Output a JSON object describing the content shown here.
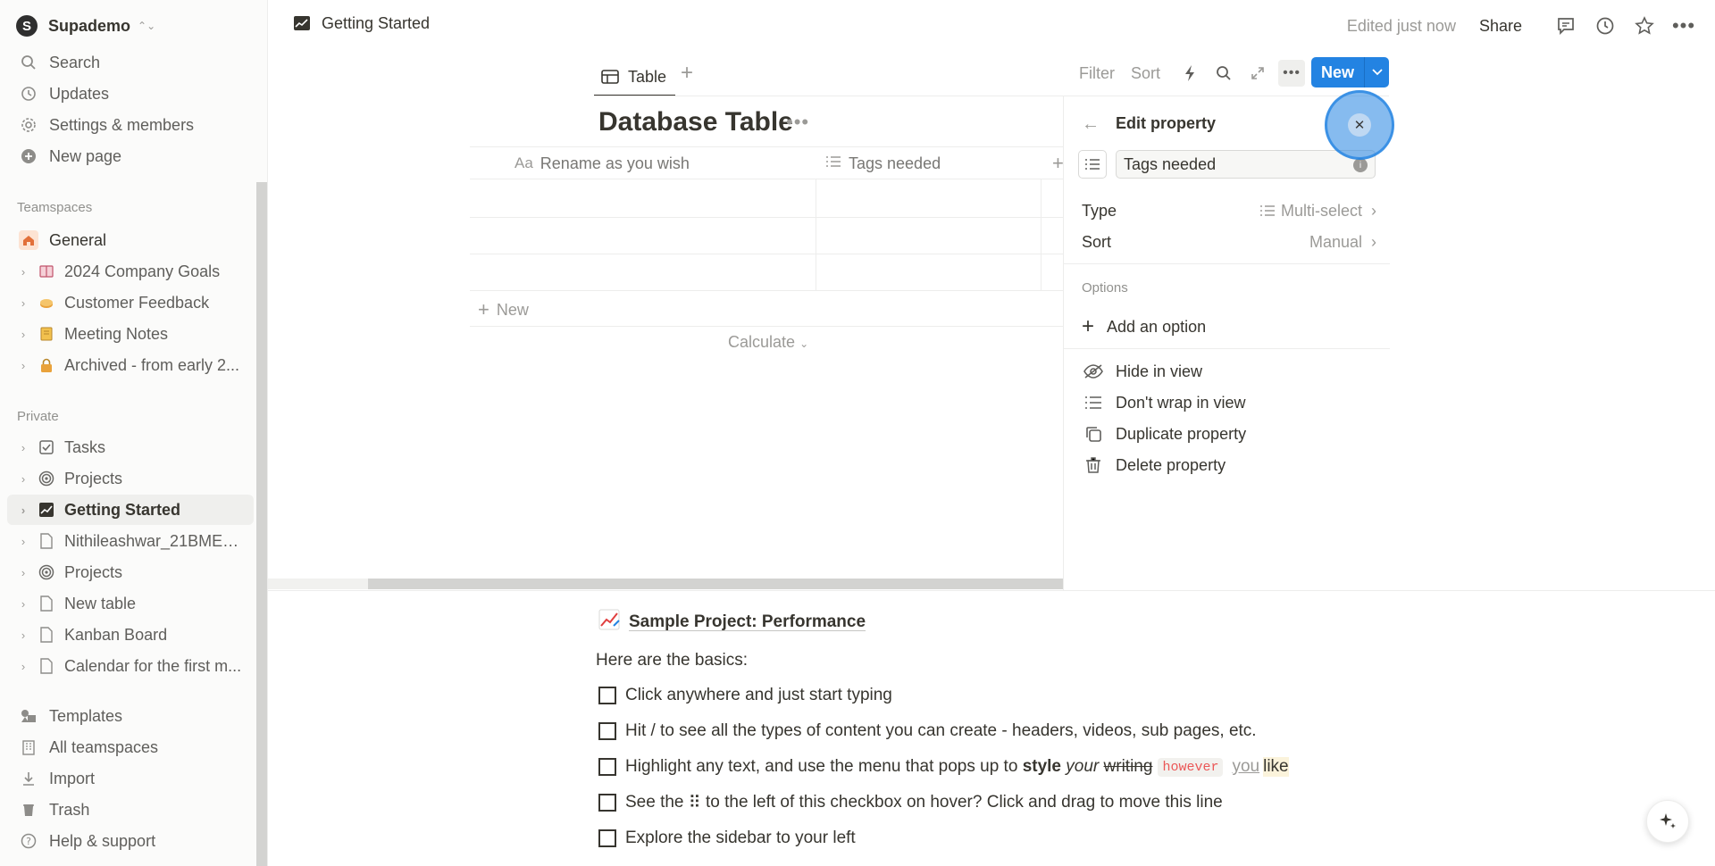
{
  "workspace": {
    "initial": "S",
    "name": "Supademo"
  },
  "sidebar": {
    "top_items": [
      {
        "label": "Search",
        "icon": "search-icon"
      },
      {
        "label": "Updates",
        "icon": "clock-icon"
      },
      {
        "label": "Settings & members",
        "icon": "gear-icon"
      },
      {
        "label": "New page",
        "icon": "plus-circle-icon"
      }
    ],
    "teamspaces_label": "Teamspaces",
    "teamspaces": [
      {
        "label": "General",
        "icon": "home-icon"
      },
      {
        "label": "2024 Company Goals",
        "icon": "book-icon"
      },
      {
        "label": "Customer Feedback",
        "icon": "pie-icon"
      },
      {
        "label": "Meeting Notes",
        "icon": "notebook-icon"
      },
      {
        "label": "Archived - from early 2...",
        "icon": "lock-icon"
      }
    ],
    "private_label": "Private",
    "private": [
      {
        "label": "Tasks",
        "icon": "checkbox-icon"
      },
      {
        "label": "Projects",
        "icon": "target-icon"
      },
      {
        "label": "Getting Started",
        "icon": "chart-icon"
      },
      {
        "label": "Nithileashwar_21BME10...",
        "icon": "page-icon"
      },
      {
        "label": "Projects",
        "icon": "target-icon"
      },
      {
        "label": "New table",
        "icon": "page-icon"
      },
      {
        "label": "Kanban Board",
        "icon": "page-icon"
      },
      {
        "label": "Calendar for the first m...",
        "icon": "page-icon"
      }
    ],
    "bottom_items": [
      {
        "label": "Templates",
        "icon": "templates-icon"
      },
      {
        "label": "All teamspaces",
        "icon": "building-icon"
      },
      {
        "label": "Import",
        "icon": "download-icon"
      },
      {
        "label": "Trash",
        "icon": "trash-icon"
      },
      {
        "label": "Help & support",
        "icon": "help-icon"
      }
    ]
  },
  "topbar": {
    "breadcrumb": "Getting Started",
    "edited": "Edited just now",
    "share": "Share"
  },
  "view": {
    "tab_label": "Table",
    "filter": "Filter",
    "sort": "Sort",
    "new_button": "New"
  },
  "database": {
    "title": "Database Table",
    "columns": [
      {
        "prefix": "Aa",
        "label": "Rename as you wish"
      },
      {
        "prefix": "list-icon",
        "label": "Tags needed"
      }
    ],
    "new_row": "New",
    "calculate": "Calculate"
  },
  "panel": {
    "title": "Edit property",
    "name_value": "Tags needed",
    "type_label": "Type",
    "type_value": "Multi-select",
    "sort_label": "Sort",
    "sort_value": "Manual",
    "options_label": "Options",
    "add_option": "Add an option",
    "actions": [
      {
        "label": "Hide in view",
        "icon": "eye-off-icon"
      },
      {
        "label": "Don't wrap in view",
        "icon": "list-icon"
      },
      {
        "label": "Duplicate property",
        "icon": "duplicate-icon"
      },
      {
        "label": "Delete property",
        "icon": "trash-icon"
      }
    ]
  },
  "content": {
    "project_link": "Sample Project: Performance",
    "basics": "Here are the basics:",
    "todos": {
      "t1": "Click anywhere and just start typing",
      "t2": "Hit / to see all the types of content you can create - headers, videos, sub pages, etc.",
      "t3_a": "Highlight any text, and use the menu that pops up to ",
      "t3_bold": "style",
      "t3_italic": "your",
      "t3_strike": "writing",
      "t3_code": "however",
      "t3_under": "you",
      "t3_hl": "like",
      "t4_a": "See the ",
      "t4_grip": "⠿",
      "t4_b": " to the left of this checkbox on hover? Click and drag to move this line",
      "t5": "Explore the sidebar to your left"
    }
  },
  "colors": {
    "accent": "#2383e2",
    "text": "#37352f",
    "muted": "#9b9a97"
  }
}
